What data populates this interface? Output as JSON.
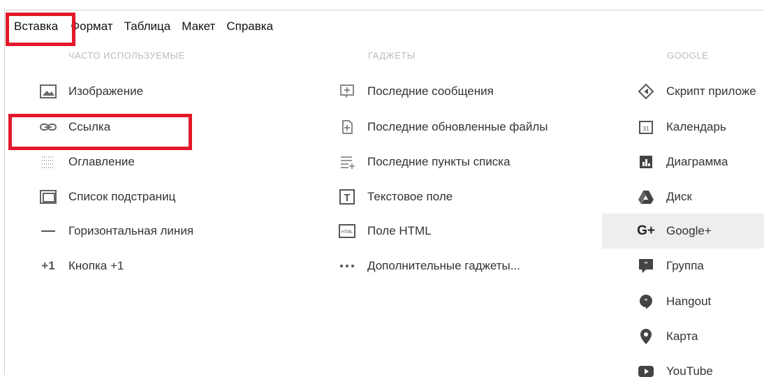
{
  "menubar": {
    "items": [
      "Вставка",
      "Формат",
      "Таблица",
      "Макет",
      "Справка"
    ]
  },
  "sections": {
    "frequent": {
      "title": "ЧАСТО ИСПОЛЬЗУЕМЫЕ",
      "items": [
        {
          "label": "Изображение",
          "icon": "image-icon"
        },
        {
          "label": "Ссылка",
          "icon": "link-icon"
        },
        {
          "label": "Оглавление",
          "icon": "table-of-contents-icon"
        },
        {
          "label": "Список подстраниц",
          "icon": "subpages-list-icon"
        },
        {
          "label": "Горизонтальная линия",
          "icon": "horizontal-line-icon"
        },
        {
          "label": "Кнопка +1",
          "icon": "plus-one-icon"
        }
      ]
    },
    "gadgets": {
      "title": "ГАДЖЕТЫ",
      "items": [
        {
          "label": "Последние сообщения",
          "icon": "recent-posts-icon"
        },
        {
          "label": "Последние обновленные файлы",
          "icon": "recent-files-icon"
        },
        {
          "label": "Последние пункты списка",
          "icon": "recent-list-items-icon"
        },
        {
          "label": "Текстовое поле",
          "icon": "text-box-icon"
        },
        {
          "label": "Поле HTML",
          "icon": "html-box-icon"
        },
        {
          "label": "Дополнительные гаджеты...",
          "icon": "more-gadgets-icon"
        }
      ]
    },
    "google": {
      "title": "GOOGLE",
      "items": [
        {
          "label": "Скрипт приложе",
          "icon": "apps-script-icon"
        },
        {
          "label": "Календарь",
          "icon": "calendar-icon"
        },
        {
          "label": "Диаграмма",
          "icon": "chart-icon"
        },
        {
          "label": "Диск",
          "icon": "drive-icon"
        },
        {
          "label": "Google+",
          "icon": "google-plus-icon"
        },
        {
          "label": "Группа",
          "icon": "group-icon"
        },
        {
          "label": "Hangout",
          "icon": "hangout-icon"
        },
        {
          "label": "Карта",
          "icon": "map-pin-icon"
        },
        {
          "label": "YouTube",
          "icon": "youtube-icon"
        }
      ]
    }
  },
  "colors": {
    "highlight": "#e3192b",
    "selected_bg": "#eeeeee",
    "section_title": "#bbbbbb",
    "text": "#333333"
  }
}
